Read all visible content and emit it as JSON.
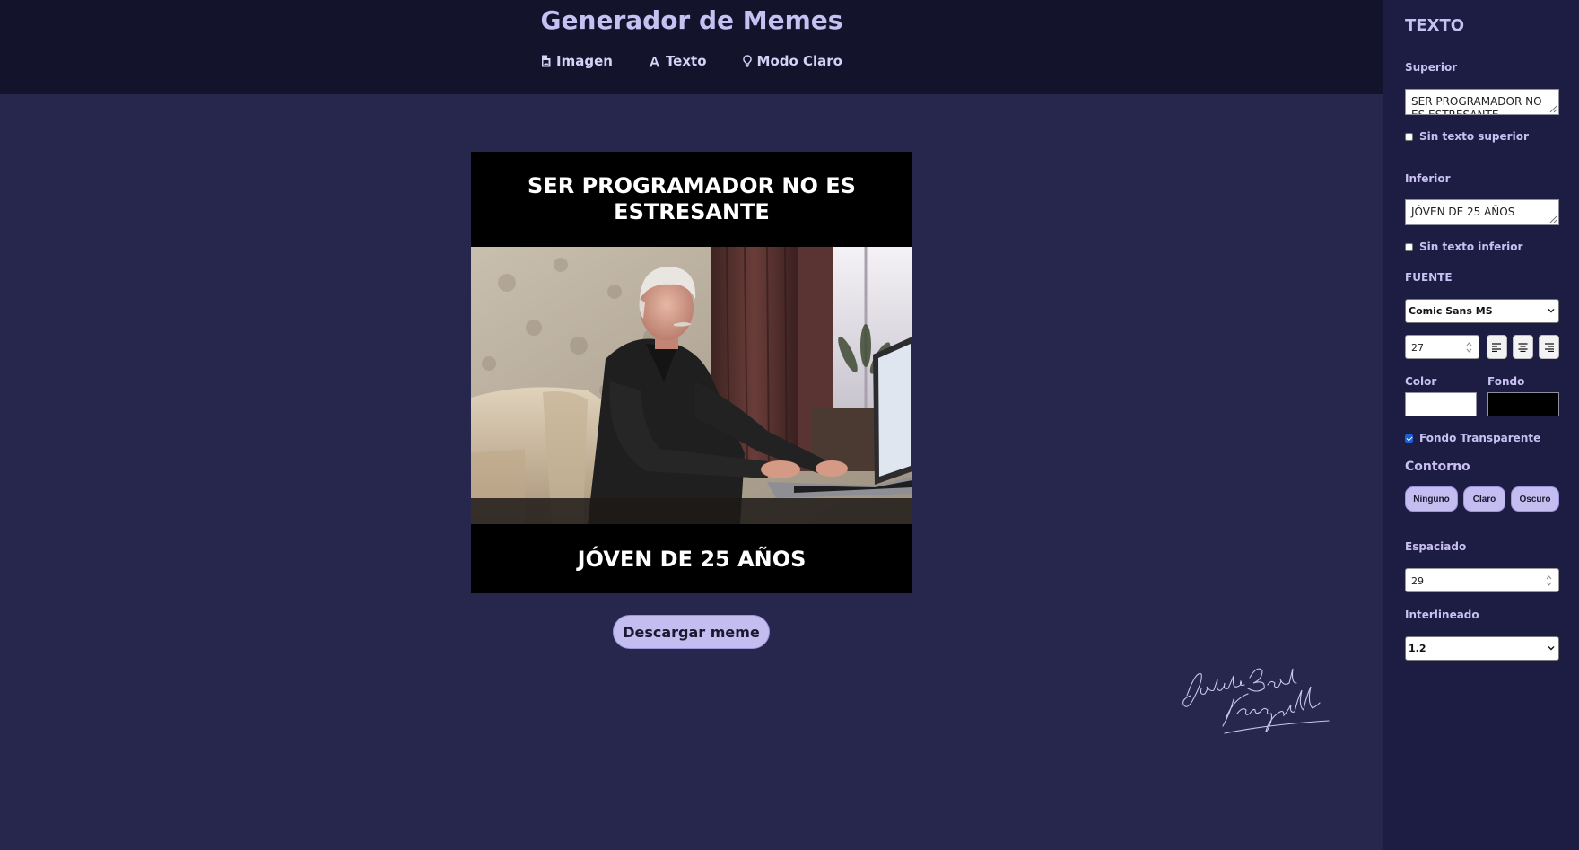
{
  "header": {
    "title": "Generador de Memes",
    "nav": [
      {
        "label": "Imagen",
        "icon": "file-image-icon"
      },
      {
        "label": "Texto",
        "icon": "font-icon"
      },
      {
        "label": "Modo Claro",
        "icon": "lightbulb-icon"
      }
    ]
  },
  "meme": {
    "top_text": "SER PROGRAMADOR NO ES ESTRESANTE",
    "bottom_text": "JÓVEN DE 25 AÑOS",
    "text_color": "#ffffff",
    "background": "#000000"
  },
  "download_label": "Descargar meme",
  "panel": {
    "title": "TEXTO",
    "top": {
      "label": "Superior",
      "value": "SER PROGRAMADOR NO ES ESTRESANTE",
      "no_text_label": "Sin texto superior",
      "no_text_checked": false
    },
    "bottom": {
      "label": "Inferior",
      "value": "JÓVEN DE 25 AÑOS",
      "no_text_label": "Sin texto inferior",
      "no_text_checked": false
    },
    "font": {
      "label": "FUENTE",
      "family": "Comic Sans MS",
      "size": "27",
      "align_options": [
        "left",
        "center",
        "right"
      ]
    },
    "color": {
      "label": "Color",
      "value": "#ffffff"
    },
    "background": {
      "label": "Fondo",
      "value": "#000000"
    },
    "transparent": {
      "label": "Fondo Transparente",
      "checked": true
    },
    "outline": {
      "label": "Contorno",
      "options": [
        "Ninguno",
        "Claro",
        "Oscuro"
      ]
    },
    "spacing": {
      "label": "Espaciado",
      "value": "29"
    },
    "line_height": {
      "label": "Interlineado",
      "value": "1.2"
    }
  },
  "colors": {
    "page_bg": "#27264d",
    "header_bg": "#13132b",
    "panel_bg": "#1d1c42",
    "accent": "#c4bdf0"
  }
}
